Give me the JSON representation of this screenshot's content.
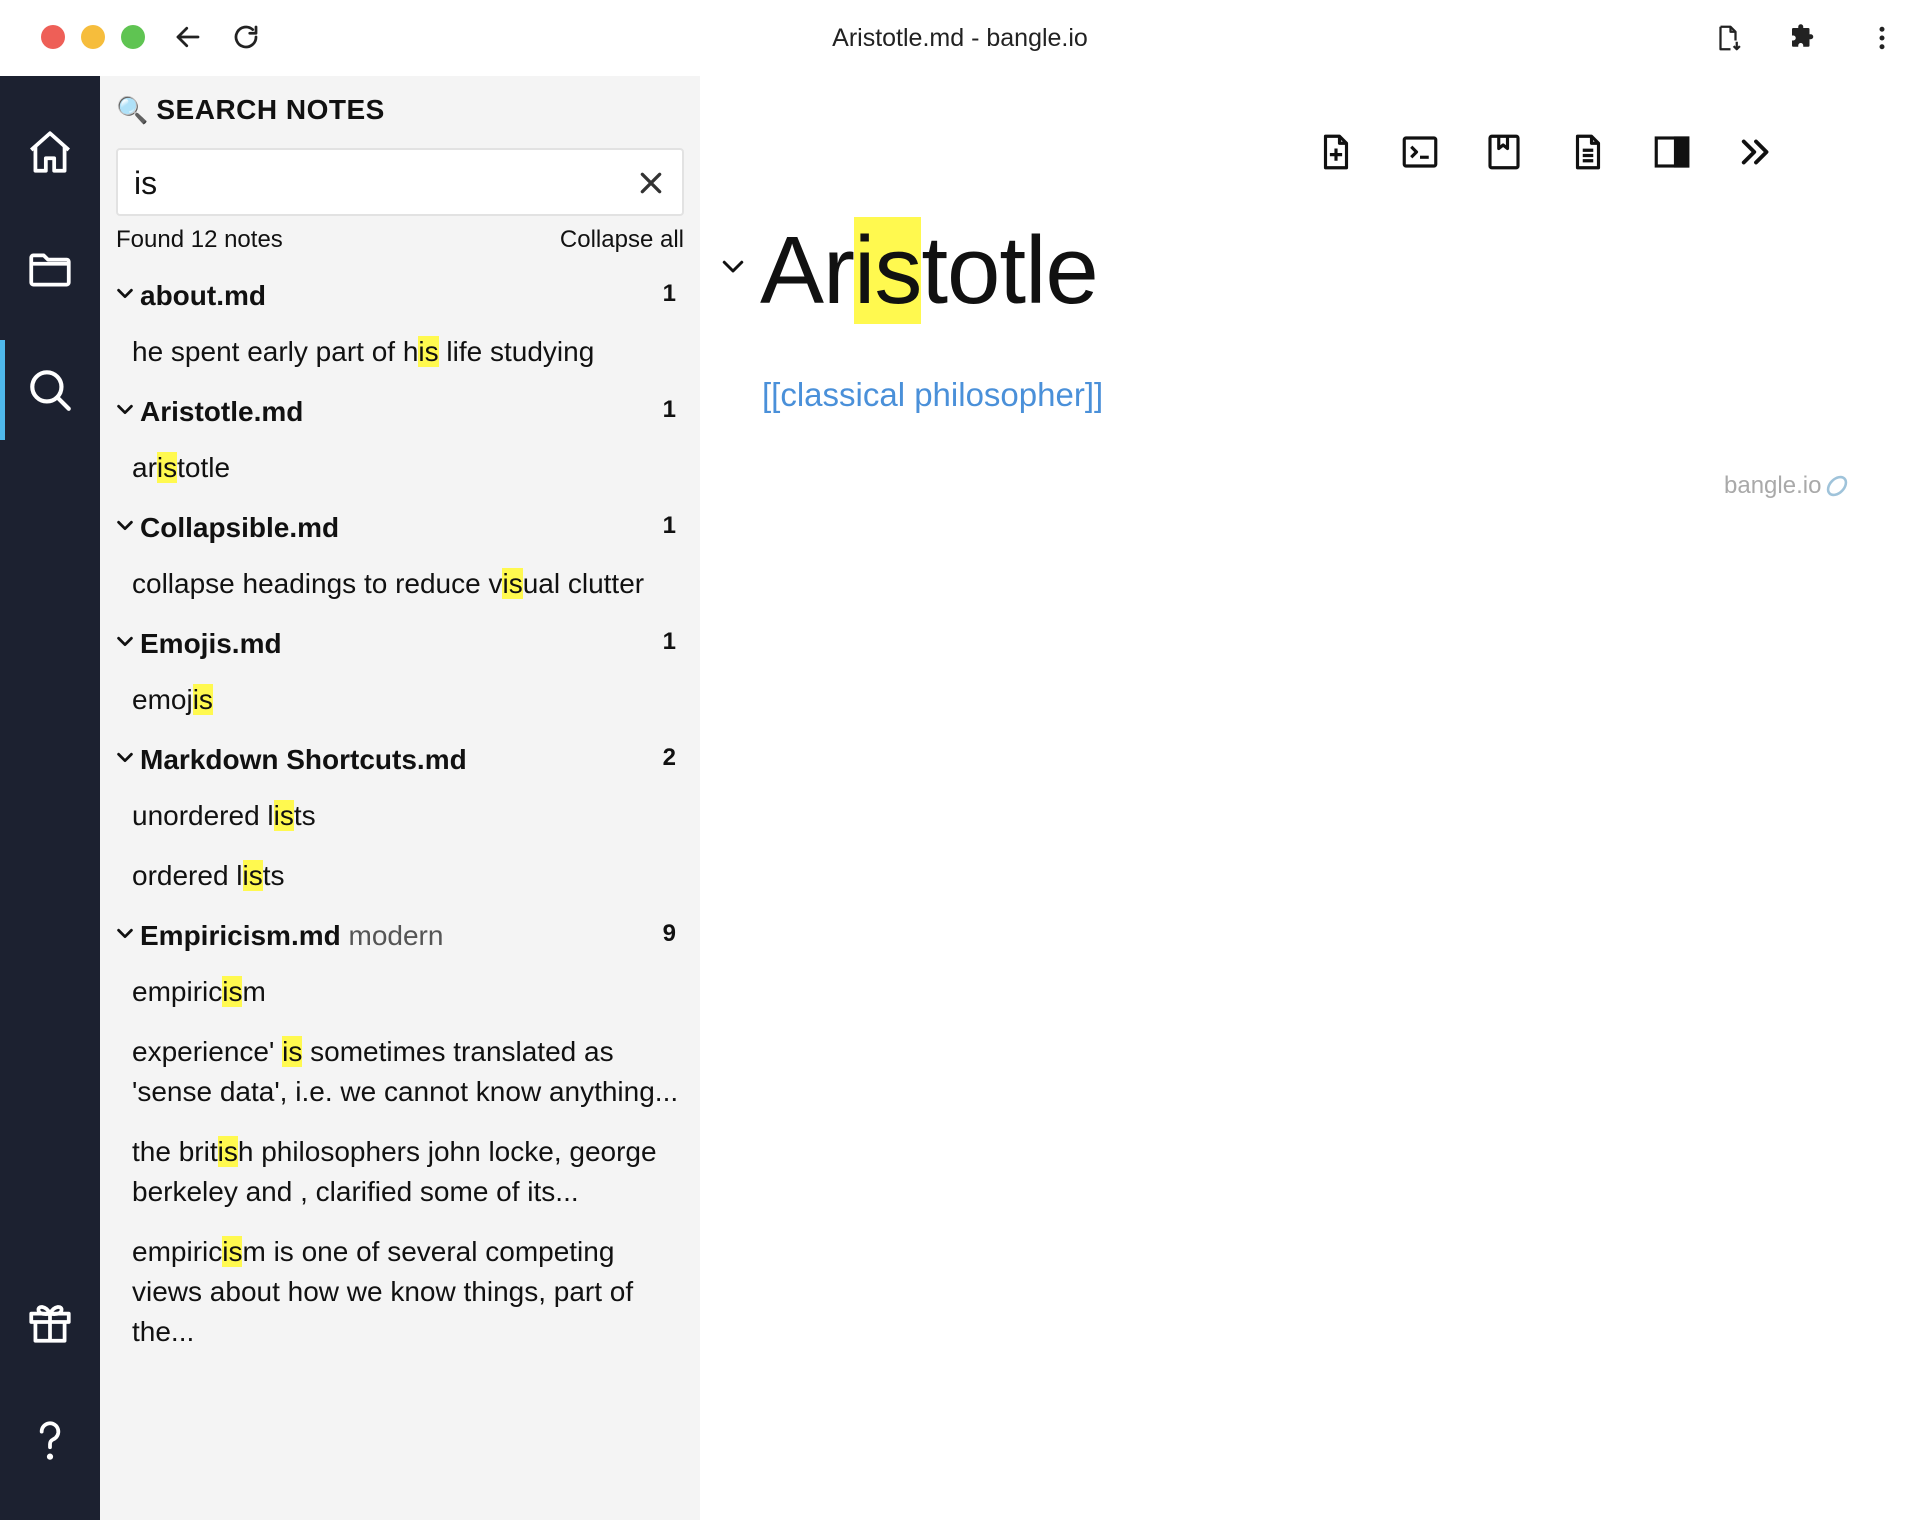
{
  "window": {
    "title": "Aristotle.md - bangle.io"
  },
  "sidebar": {
    "header_icon": "🔍",
    "title": "SEARCH NOTES",
    "search_value": "is",
    "found_text": "Found 12 notes",
    "collapse_label": "Collapse all",
    "results": [
      {
        "file": "about.md",
        "tag": "",
        "count": "1",
        "matches": [
          {
            "pre": "he spent early part of h",
            "hl": "is",
            "post": " life studying"
          }
        ]
      },
      {
        "file": "Aristotle.md",
        "tag": "",
        "count": "1",
        "matches": [
          {
            "pre": "ar",
            "hl": "is",
            "post": "totle"
          }
        ]
      },
      {
        "file": "Collapsible.md",
        "tag": "",
        "count": "1",
        "matches": [
          {
            "pre": "collapse headings to reduce v",
            "hl": "is",
            "post": "ual clutter"
          }
        ]
      },
      {
        "file": "Emojis.md",
        "tag": "",
        "count": "1",
        "matches": [
          {
            "pre": "emoj",
            "hl": "is",
            "post": ""
          }
        ]
      },
      {
        "file": "Markdown Shortcuts.md",
        "tag": "",
        "count": "2",
        "matches": [
          {
            "pre": "unordered l",
            "hl": "is",
            "post": "ts"
          },
          {
            "pre": "ordered l",
            "hl": "is",
            "post": "ts"
          }
        ]
      },
      {
        "file": "Empiricism.md",
        "tag": "modern",
        "count": "9",
        "matches": [
          {
            "pre": "empiric",
            "hl": "is",
            "post": "m"
          },
          {
            "pre": "experience' ",
            "hl": "is",
            "post": " sometimes translated as 'sense data', i.e. we cannot know anything..."
          },
          {
            "pre": "the brit",
            "hl": "is",
            "post": "h philosophers john locke, george berkeley and , clarified some of its..."
          },
          {
            "pre": "empiric",
            "hl": "is",
            "post": "m is one of several competing views about how we know things, part of the..."
          }
        ]
      }
    ]
  },
  "editor": {
    "title_pre": "Ar",
    "title_hl": "is",
    "title_post": "totle",
    "link_text": "[[classical philosopher]]",
    "watermark": "bangle.io"
  },
  "icons": {
    "back": "arrow-left-icon",
    "reload": "reload-icon",
    "download": "file-download-icon",
    "extensions": "puzzle-icon",
    "menu": "more-vertical-icon",
    "home": "home-icon",
    "folder": "folder-icon",
    "search": "search-icon",
    "gift": "gift-icon",
    "help": "question-icon"
  },
  "colors": {
    "activity_bar": "#1c2130",
    "active_indicator": "#4fb8ea",
    "sidebar_bg": "#f4f4f4",
    "highlight": "#fff94f",
    "link": "#4a90d9"
  }
}
